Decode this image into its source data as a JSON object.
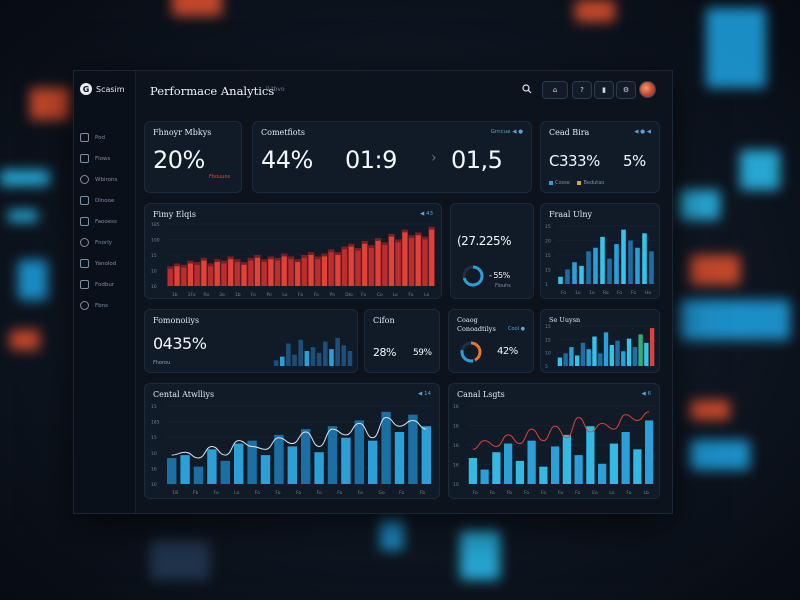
{
  "sidebar": {
    "brand": {
      "logo": "G",
      "name": "Scasim"
    },
    "items": [
      {
        "label": "Pod",
        "icon": "search-icon"
      },
      {
        "label": "Flows",
        "icon": "document-icon"
      },
      {
        "label": "Wbirons",
        "icon": "settings-icon"
      },
      {
        "label": "Dlnooe",
        "icon": "folder-icon"
      },
      {
        "label": "Faooess",
        "icon": "folder-icon"
      },
      {
        "label": "Fnorly",
        "icon": "globe-icon"
      },
      {
        "label": "Yanolod",
        "icon": "chart-icon"
      },
      {
        "label": "Fodbur",
        "icon": "grid-icon"
      },
      {
        "label": "Fbns",
        "icon": "gear-icon"
      }
    ]
  },
  "header": {
    "title": "Performace Analytics",
    "subtitle": "ll tbvo",
    "buttons": [
      "⌂",
      "?",
      "▮",
      "⚙"
    ]
  },
  "cards": {
    "c1": {
      "title": "Fhnoyr Mbkys",
      "value": "20%",
      "note": "Fbouuos"
    },
    "c2": {
      "title": "Cometfiots",
      "tag": "Grncue ◀ ●",
      "v1": "44%",
      "v2": "01:9",
      "arrow": "›",
      "v3": "01,5"
    },
    "c3": {
      "title": "Cead Bira",
      "tag": "◀ ● ◀",
      "v1": "C333%",
      "v2": "5%",
      "legend1": "Cosse",
      "legend2": "Bedutao"
    },
    "c4": {
      "title": "Fimy Elqis",
      "tag": "◀ 43"
    },
    "c5": {
      "value": "(27.225%",
      "ring": "- 55%",
      "note": "Fiouhs"
    },
    "c6": {
      "title": "Fraal Ulny"
    },
    "c7": {
      "title": "Fomonoiiys",
      "value": "0435%",
      "note": "Fhorou"
    },
    "c8": {
      "title": "Cifon",
      "v1": "28%",
      "v2": "59%"
    },
    "c9": {
      "title": "Coaog",
      "title2": "Conoadtilys",
      "tag": "Cool ●",
      "value": "42%"
    },
    "c10": {
      "title": "Se Uuysn"
    },
    "c11": {
      "title": "Cental Atwlliys",
      "tag": "◀ 14"
    },
    "c12": {
      "title": "Canal Lsgts",
      "tag": "◀ 6"
    }
  },
  "colors": {
    "accent_blue": "#2b9fd8",
    "accent_cyan": "#34c3ea",
    "accent_red": "#e0423a",
    "accent_green": "#2fb07b"
  },
  "chart_data": [
    {
      "id": "fimy-elqis",
      "type": "bar",
      "title": "Fimy Elqis",
      "categories": [
        "1b",
        "1Fo",
        "Ro",
        "3o",
        "1b",
        "Fo",
        "Po",
        "Lo",
        "Fo",
        "Fo",
        "Po",
        "Dlo",
        "Fo",
        "Co",
        "Lo",
        "Fo",
        "Lo"
      ],
      "yticks": [
        "185",
        "100",
        "15",
        "10",
        "16"
      ],
      "series": [
        {
          "values": [
            12,
            14,
            13,
            16,
            15,
            18,
            14,
            17,
            16,
            19,
            17,
            15,
            18,
            20,
            17,
            19,
            18,
            21,
            19,
            17,
            20,
            22,
            19,
            21,
            24,
            22,
            26,
            28,
            25,
            30,
            27,
            32,
            29,
            35,
            31,
            38,
            34,
            36,
            33,
            40
          ]
        },
        {
          "values": [
            14,
            16,
            15,
            18,
            17,
            20,
            16,
            19,
            18,
            21,
            19,
            17,
            20,
            22,
            19,
            21,
            20,
            23,
            21,
            19,
            22,
            24,
            21,
            23,
            26,
            24,
            28,
            30,
            27,
            32,
            29,
            34,
            31,
            37,
            33,
            40,
            36,
            38,
            35,
            42
          ]
        }
      ]
    },
    {
      "id": "fraal-ulny",
      "type": "bar",
      "title": "Fraal Ulny",
      "categories": [
        "Fo",
        "1o",
        "1o",
        "Ro",
        "Fo",
        "Fo",
        "Ho"
      ],
      "yticks": [
        "15",
        "20",
        "15",
        "15",
        "1"
      ],
      "series": [
        {
          "values": [
            2,
            4,
            6,
            5,
            9,
            10,
            13,
            7,
            11,
            15,
            12,
            10,
            14,
            9
          ]
        }
      ]
    },
    {
      "id": "fomonoiiys",
      "type": "bar",
      "title": "Fomonoiiys",
      "series": [
        {
          "values": [
            3,
            5,
            12,
            6,
            14,
            8,
            10,
            7,
            13,
            9,
            15,
            11,
            8
          ]
        }
      ]
    },
    {
      "id": "se-uuysn",
      "type": "bar",
      "title": "Se Uuysn",
      "yticks": [
        "15",
        "15",
        "10",
        "5"
      ],
      "series": [
        {
          "values": [
            4,
            6,
            9,
            5,
            11,
            8,
            14,
            6,
            16,
            10,
            12,
            7,
            13,
            9,
            15,
            11,
            18
          ]
        }
      ]
    },
    {
      "id": "cental-atwlliys",
      "type": "bar",
      "title": "Cental Atwlliys",
      "categories": [
        "18",
        "Fb",
        "Fo",
        "Lo",
        "Fo",
        "Fo",
        "Fo",
        "Fo",
        "Fo",
        "Fo",
        "Go",
        "Fo",
        "Fb"
      ],
      "yticks": [
        "15",
        "185",
        "15",
        "10",
        "16",
        "10"
      ],
      "series": [
        {
          "name": "bars",
          "values": [
            18,
            20,
            12,
            24,
            16,
            28,
            30,
            20,
            34,
            26,
            38,
            22,
            40,
            32,
            44,
            30,
            50,
            36,
            48,
            40
          ]
        },
        {
          "name": "line",
          "values": [
            20,
            22,
            18,
            26,
            20,
            30,
            26,
            24,
            32,
            28,
            36,
            26,
            38,
            34,
            42,
            32,
            46,
            40,
            44,
            38
          ]
        }
      ]
    },
    {
      "id": "canal-lsgts",
      "type": "bar",
      "title": "Canal Lsgts",
      "categories": [
        "Fo",
        "Fo",
        "Fb",
        "Fo",
        "Fo",
        "Fo",
        "Fo",
        "Eo",
        "Lo",
        "Fo",
        "Lb"
      ],
      "yticks": [
        "16",
        "16",
        "16",
        "16",
        "10"
      ],
      "series": [
        {
          "name": "bars",
          "values": [
            18,
            10,
            22,
            28,
            16,
            30,
            12,
            26,
            34,
            20,
            40,
            14,
            28,
            36,
            24,
            44
          ]
        },
        {
          "name": "line",
          "values": [
            24,
            30,
            26,
            34,
            28,
            38,
            30,
            40,
            32,
            46,
            36,
            42,
            38,
            48,
            44,
            50
          ]
        }
      ]
    }
  ]
}
